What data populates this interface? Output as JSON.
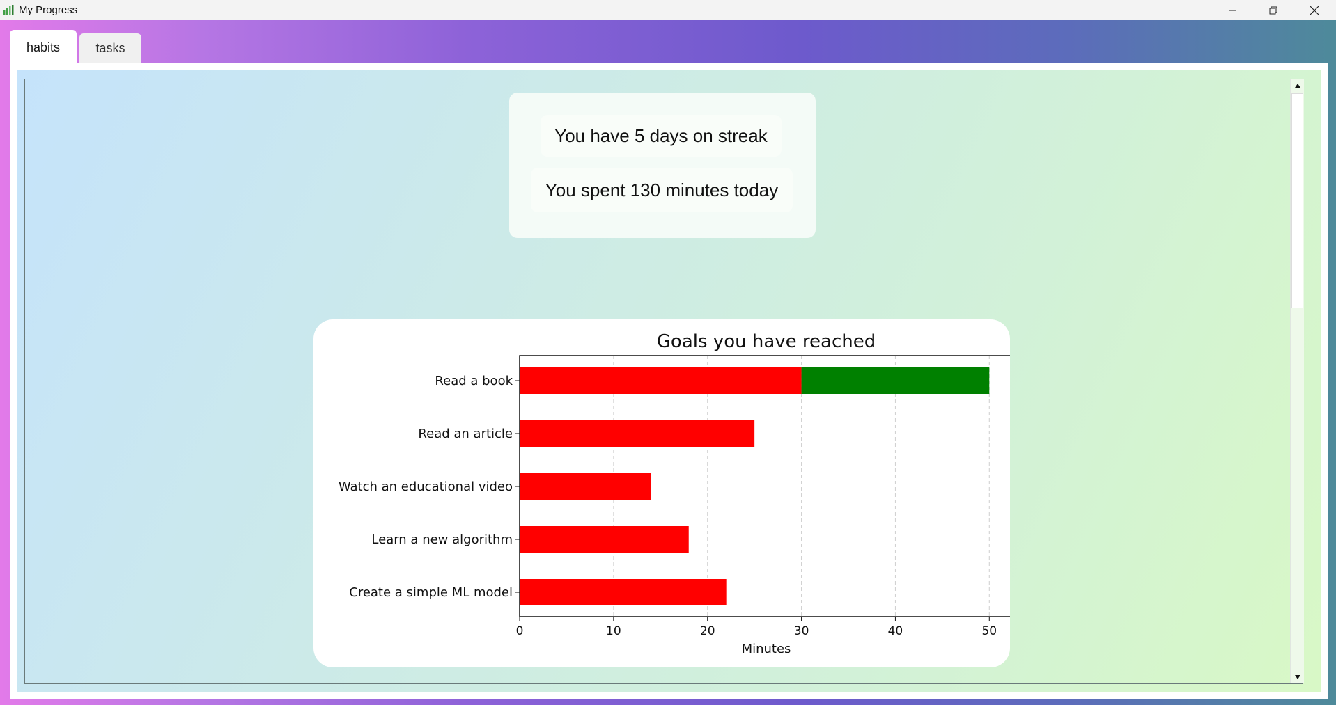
{
  "window": {
    "title": "My Progress",
    "controls": [
      "minimize",
      "restore",
      "close"
    ]
  },
  "tabs": [
    {
      "label": "habits",
      "active": true
    },
    {
      "label": "tasks",
      "active": false
    }
  ],
  "stats": {
    "streak_text": "You have 5 days on streak",
    "minutes_text": "You spent 130 minutes today"
  },
  "chart_data": {
    "type": "bar",
    "orientation": "horizontal",
    "stacked": true,
    "title": "Goals you have reached",
    "xlabel": "Minutes",
    "ylabel": "",
    "xlim": [
      0,
      52.5
    ],
    "xticks": [
      0,
      10,
      20,
      30,
      40,
      50
    ],
    "grid": "x-dashed",
    "categories": [
      "Read a book",
      "Read an article",
      "Watch an educational video",
      "Learn a new algorithm",
      "Create a simple ML model"
    ],
    "series": [
      {
        "color": "#ff0000",
        "values": [
          30,
          25,
          14,
          18,
          22
        ]
      },
      {
        "color": "#008000",
        "values": [
          20,
          0,
          0,
          0,
          0
        ]
      }
    ]
  },
  "colors": {
    "progress_bar": "#ff0000",
    "goal_reached_bar": "#008000"
  }
}
